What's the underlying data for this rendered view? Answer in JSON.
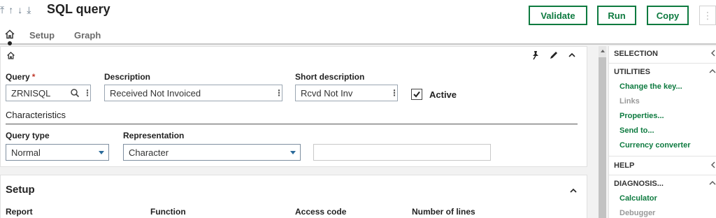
{
  "header": {
    "nav_arrows": [
      "⤒",
      "↑",
      "↓",
      "⤓"
    ],
    "title": "SQL query",
    "buttons": {
      "validate": "Validate",
      "run": "Run",
      "copy": "Copy"
    },
    "more": "⋮"
  },
  "tabs": {
    "setup": "Setup",
    "graph": "Graph"
  },
  "form": {
    "query_label": "Query",
    "required_mark": "*",
    "query_value": "ZRNISQL",
    "description_label": "Description",
    "description_value": "Received Not Invoiced",
    "short_description_label": "Short description",
    "short_description_value": "Rcvd Not Inv",
    "active_label": "Active",
    "active_checked": true,
    "characteristics_title": "Characteristics",
    "query_type_label": "Query type",
    "query_type_value": "Normal",
    "representation_label": "Representation",
    "representation_value": "Character",
    "extra_value": ""
  },
  "setup": {
    "title": "Setup",
    "columns": {
      "report": "Report",
      "function": "Function",
      "access_code": "Access code",
      "number_of_lines": "Number of lines"
    }
  },
  "sidebar": {
    "selection": "SELECTION",
    "utilities": "UTILITIES",
    "utilities_items": [
      "Change the key...",
      "Links",
      "Properties...",
      "Send to...",
      "Currency converter"
    ],
    "help": "HELP",
    "diagnosis": "DIAGNOSIS...",
    "diagnosis_items": [
      "Calculator",
      "Debugger"
    ]
  },
  "colors": {
    "accent": "#0d7a3f",
    "required": "#c0392b"
  },
  "icons": {
    "home": "home-icon",
    "pin": "pin-icon",
    "edit": "pencil-icon",
    "collapse": "chevron-up-icon",
    "search": "search-icon",
    "check": "check-icon"
  }
}
